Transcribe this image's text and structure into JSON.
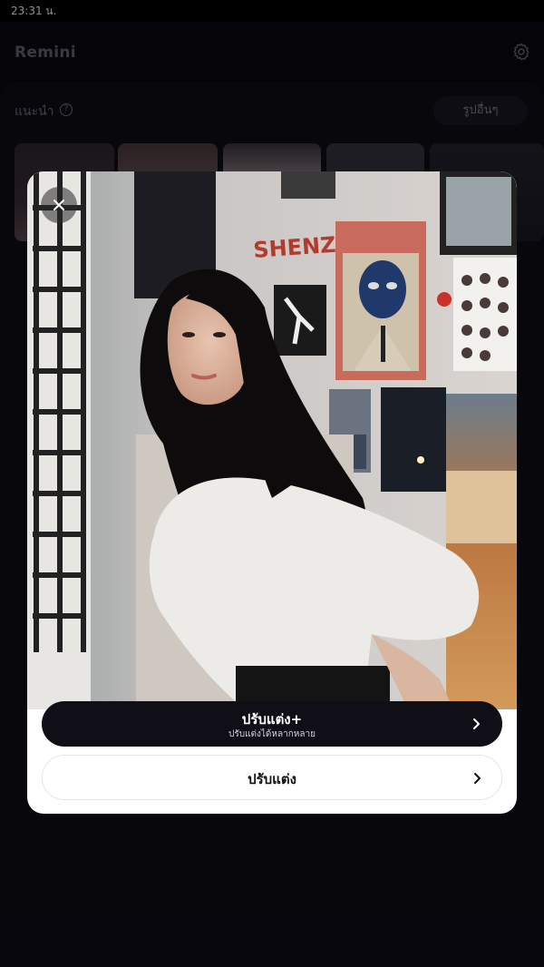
{
  "status_bar": {
    "time": "23:31 น."
  },
  "header": {
    "app_title": "Remini",
    "settings_icon": "gear-icon"
  },
  "recommended": {
    "title": "แนะนำ",
    "help_icon": "help-circle-icon",
    "other_photos_label": "รูปอื่นๆ"
  },
  "modal": {
    "photo_poster_text": "SHENZHEN",
    "close_icon": "close-icon",
    "primary_button": {
      "label": "ปรับแต่ง+",
      "sublabel": "ปรับแต่งได้หลากหลาย",
      "icon": "chevron-right-icon"
    },
    "secondary_button": {
      "label": "ปรับแต่ง",
      "icon": "chevron-right-icon"
    }
  }
}
